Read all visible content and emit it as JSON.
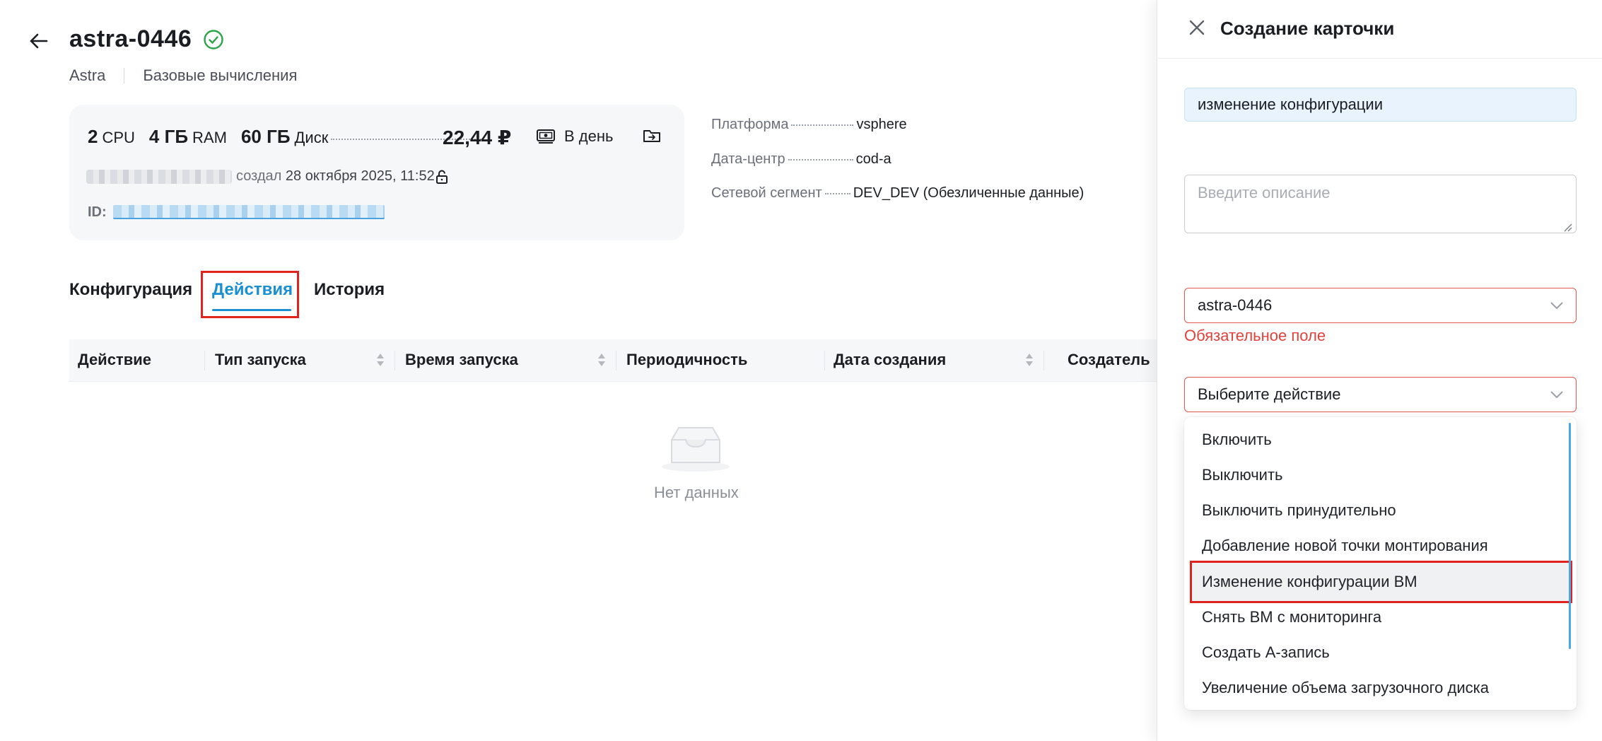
{
  "header": {
    "title": "astra-0446",
    "breadcrumbs": [
      "Astra",
      "Базовые вычисления"
    ]
  },
  "summary": {
    "cpu_value": "2",
    "cpu_unit": "CPU",
    "ram_value": "4 ГБ",
    "ram_unit": "RAM",
    "disk_value": "60 ГБ",
    "disk_unit": "Диск",
    "price": "22,44 ₽",
    "billing_period": "В день",
    "created_label": "создал",
    "created_datetime": "28 октября 2025, 11:52",
    "id_label": "ID:"
  },
  "platform": {
    "platform_label": "Платформа",
    "platform_value": "vsphere",
    "datacenter_label": "Дата-центр",
    "datacenter_value": "cod-a",
    "segment_label": "Сетевой сегмент",
    "segment_value": "DEV_DEV (Обезличенные данные)"
  },
  "tabs": [
    {
      "label": "Конфигурация",
      "active": false
    },
    {
      "label": "Действия",
      "active": true
    },
    {
      "label": "История",
      "active": false
    }
  ],
  "table": {
    "columns": [
      "Действие",
      "Тип запуска",
      "Время запуска",
      "Периодичность",
      "Дата создания",
      "Создатель"
    ],
    "empty_text": "Нет данных"
  },
  "drawer": {
    "title": "Создание карточки",
    "name_value": "изменение конфигурации",
    "description_placeholder": "Введите описание",
    "vm_value": "astra-0446",
    "vm_error": "Обязательное поле",
    "action_placeholder": "Выберите действие",
    "options": [
      "Включить",
      "Выключить",
      "Выключить принудительно",
      "Добавление новой точки монтирования",
      "Изменение конфигурации ВМ",
      "Снять ВМ с мониторинга",
      "Создать А-запись",
      "Увеличение объема загрузочного диска"
    ],
    "highlighted_option": "Изменение конфигурации ВМ"
  },
  "colors": {
    "accent": "#1a8fd1",
    "error": "#e2423b",
    "annotation": "#e0231f",
    "success": "#2ba44a"
  }
}
